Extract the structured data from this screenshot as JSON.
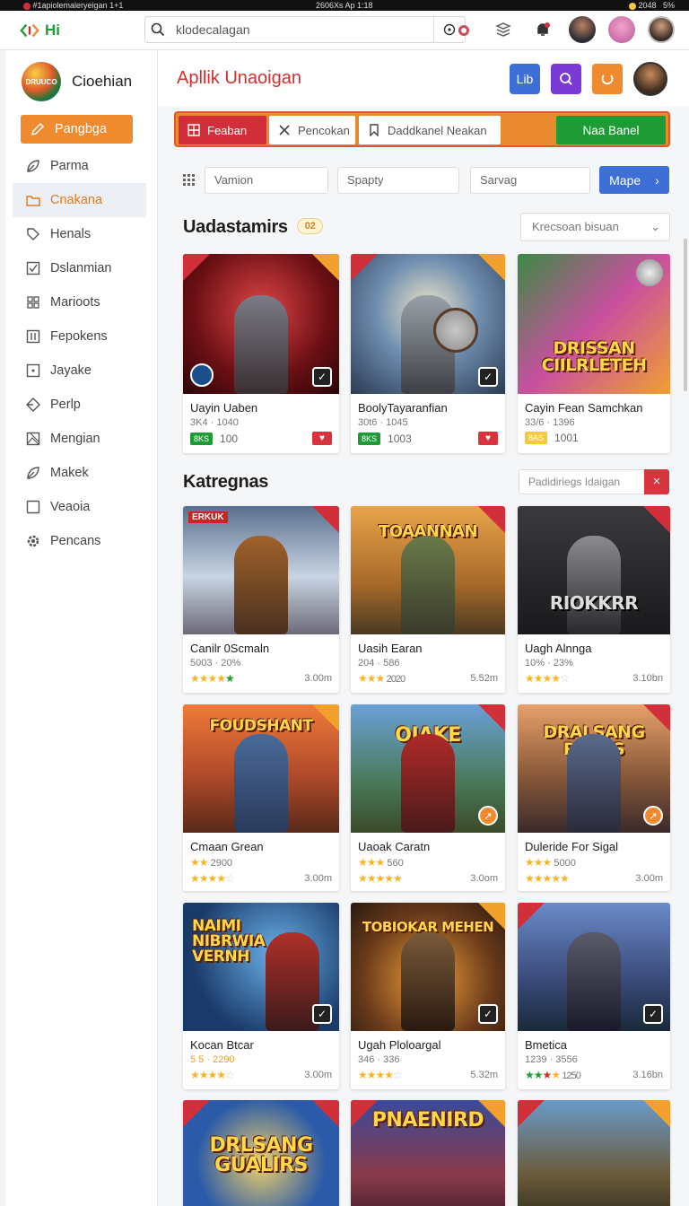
{
  "status_bar": {
    "left": "#1apiolemaleryeigan",
    "left2": "1+1",
    "center": "2606Xs Ap 1:18",
    "right": "2048",
    "right2": "5%"
  },
  "top_bar": {
    "logo_text": "Hi",
    "search_value": "klodecalagan"
  },
  "sidebar": {
    "brand_name": "Cioehian",
    "brand_badge": "DRUUCO",
    "items": [
      {
        "label": "Pangbga",
        "icon": "pencil-icon"
      },
      {
        "label": "Parma",
        "icon": "leaf-icon"
      },
      {
        "label": "Cnakana",
        "icon": "folder-icon"
      },
      {
        "label": "Henals",
        "icon": "tag-icon"
      },
      {
        "label": "Dslanmian",
        "icon": "checkbox-icon"
      },
      {
        "label": "Marioots",
        "icon": "grid-icon"
      },
      {
        "label": "Fepokens",
        "icon": "columns-icon"
      },
      {
        "label": "Jayake",
        "icon": "square-dot-icon"
      },
      {
        "label": "Perlp",
        "icon": "diamond-icon"
      },
      {
        "label": "Mengian",
        "icon": "image-icon"
      },
      {
        "label": "Makek",
        "icon": "leaf-icon"
      },
      {
        "label": "Veaoia",
        "icon": "square-icon"
      },
      {
        "label": "Pencans",
        "icon": "gear-icon"
      }
    ]
  },
  "header": {
    "title": "Apllik Unaoigan",
    "btn1_label": "Lib",
    "colors": {
      "btn1": "#3d6fd6",
      "btn2": "#7a3ad6",
      "btn3": "#f08a2f"
    }
  },
  "tabs": [
    {
      "label": "Feaban"
    },
    {
      "label": "Pencokan"
    },
    {
      "label": "Daddkanel Neakan"
    },
    {
      "label": "Naa Banel"
    }
  ],
  "filters": {
    "f1": "Vamion",
    "f2": "Spapty",
    "f3": "Sarvag",
    "button": "Mape"
  },
  "section1": {
    "title": "Uadastamirs",
    "badge": "02",
    "sort": "Krecsoan bisuan",
    "cards": [
      {
        "name": "Uayin Uaben",
        "meta": "3K4 · 1040",
        "pill": "8KS",
        "pill_color": "#1e9b35",
        "count": "100"
      },
      {
        "name": "BoolyTayaranfian",
        "meta": "30t6 · 1045",
        "pill": "8KS",
        "pill_color": "#1e9b35",
        "count": "1003"
      },
      {
        "name": "Cayin Fean Samchkan",
        "meta": "33/6 · 1396",
        "pill": "8AS",
        "pill_color": "#f5c93a",
        "count": "1001",
        "art_text": "DRISSAN CIILRLETEH"
      }
    ]
  },
  "section2": {
    "title": "Katregnas",
    "search_placeholder": "Padidiriegs Idaigan",
    "cards": [
      {
        "name": "Canilr 0Scmaln",
        "meta": "5003 · 20%",
        "stars": "4",
        "size": "3.00m",
        "art_text": "ERKUK"
      },
      {
        "name": "Uasih Earan",
        "meta": "204 · 586",
        "stars": "2020",
        "size": "5.52m",
        "art_text": "TOAANNAN"
      },
      {
        "name": "Uagh Alnnga",
        "meta": "10% · 23%",
        "stars": "",
        "size": "3.10bn",
        "art_text": "RIOKKRR"
      },
      {
        "name": "Cmaan Grean",
        "meta": "2900",
        "stars": "",
        "size": "3.00m",
        "art_text": "FOUDSHANT"
      },
      {
        "name": "Uaoak Caratn",
        "meta": "560",
        "stars": "",
        "size": "3.0om",
        "art_text": "OIAKE"
      },
      {
        "name": "Duleride For Sigal",
        "meta": "5000",
        "stars": "",
        "size": "3.00m",
        "art_text": "DRALSANG PIAKIS"
      },
      {
        "name": "Kocan Btcar",
        "meta": "5 5 · 2290",
        "stars": "",
        "size": "3.00m",
        "art_text": "NAIMI NIBRWIA VERNH"
      },
      {
        "name": "Ugah Ploloargal",
        "meta": "346 · 336",
        "stars": "",
        "size": "5.32m",
        "art_text": "TOBIOKAR MEHEN"
      },
      {
        "name": "Bmetica",
        "meta": "1239 · 3556",
        "stars": "1250",
        "size": "3.16bn",
        "art_text": ""
      },
      {
        "name": "",
        "meta": "",
        "stars": "",
        "size": "",
        "art_text": "DRLSANG GUALIRS"
      },
      {
        "name": "",
        "meta": "",
        "stars": "",
        "size": "",
        "art_text": "PNAENIRD"
      },
      {
        "name": "",
        "meta": "",
        "stars": "",
        "size": "",
        "art_text": ""
      }
    ]
  }
}
